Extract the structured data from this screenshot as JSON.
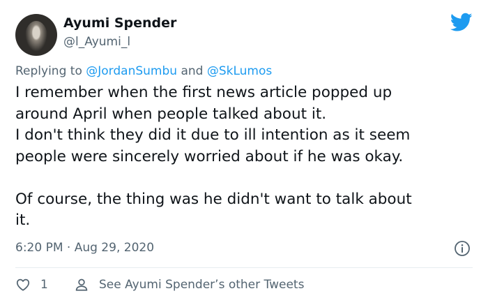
{
  "author": {
    "name": "Ayumi Spender",
    "handle": "@l_Ayumi_l"
  },
  "icons": {
    "brand": "twitter-bird-icon",
    "info": "info-icon",
    "like": "heart-icon",
    "profile": "person-icon"
  },
  "colors": {
    "brand_blue": "#1d9bf0",
    "secondary_text": "#536471",
    "primary_text": "#0f1419"
  },
  "reply": {
    "prefix": "Replying to",
    "mention_1": "@JordanSumbu",
    "conjunction": "and",
    "mention_2": "@SkLumos"
  },
  "tweet": {
    "lines": [
      "I remember when the first news article popped up",
      "around April when people talked about it.",
      "I don't think they did it due to ill intention as it seem",
      "people were sincerely worried about if he was okay.",
      "",
      "Of course, the thing was he didn't want to talk about",
      "it."
    ],
    "timestamp": "6:20 PM · Aug 29, 2020"
  },
  "actions": {
    "like_count": "1",
    "more_tweets_label": "See Ayumi Spender’s other Tweets"
  }
}
